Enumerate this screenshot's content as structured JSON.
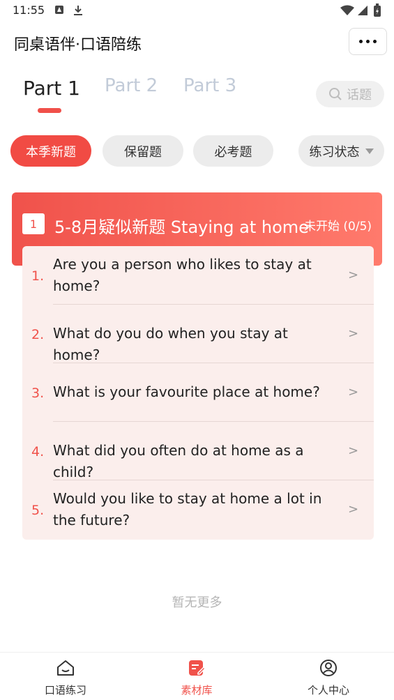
{
  "status_bar": {
    "time": "11:55"
  },
  "header": {
    "title": "同桌语伴·口语陪练"
  },
  "part_tabs": [
    {
      "label": "Part 1",
      "active": true
    },
    {
      "label": "Part 2",
      "active": false
    },
    {
      "label": "Part 3",
      "active": false
    }
  ],
  "search": {
    "placeholder": "话题"
  },
  "filters": [
    {
      "label": "本季新题",
      "active": true
    },
    {
      "label": "保留题",
      "active": false
    },
    {
      "label": "必考题",
      "active": false
    },
    {
      "label": "练习状态",
      "active": false,
      "dropdown": true
    }
  ],
  "topic": {
    "index": "1",
    "title": "5-8月疑似新题 Staying at home",
    "status": "未开始 (0/5)",
    "questions": [
      {
        "num": "1.",
        "text": "Are you a person who likes to stay at home?",
        "arrow": ">"
      },
      {
        "num": "2.",
        "text": "What do you do when you stay at home?",
        "arrow": ">"
      },
      {
        "num": "3.",
        "text": "What is your favourite place at home?",
        "arrow": ">"
      },
      {
        "num": "4.",
        "text": "What did you often do at home as a child?",
        "arrow": ">"
      },
      {
        "num": "5.",
        "text": "Would you like to stay at home a lot in the future?",
        "arrow": ">"
      }
    ]
  },
  "footer_note": "暂无更多",
  "bottom_nav": [
    {
      "label": "口语练习",
      "icon": "home-icon",
      "active": false
    },
    {
      "label": "素材库",
      "icon": "notes-icon",
      "active": true
    },
    {
      "label": "个人中心",
      "icon": "user-icon",
      "active": false
    }
  ],
  "colors": {
    "accent": "#f0524b",
    "inactive_tab": "#c2cbd8",
    "card_bg": "#fbeeec"
  }
}
